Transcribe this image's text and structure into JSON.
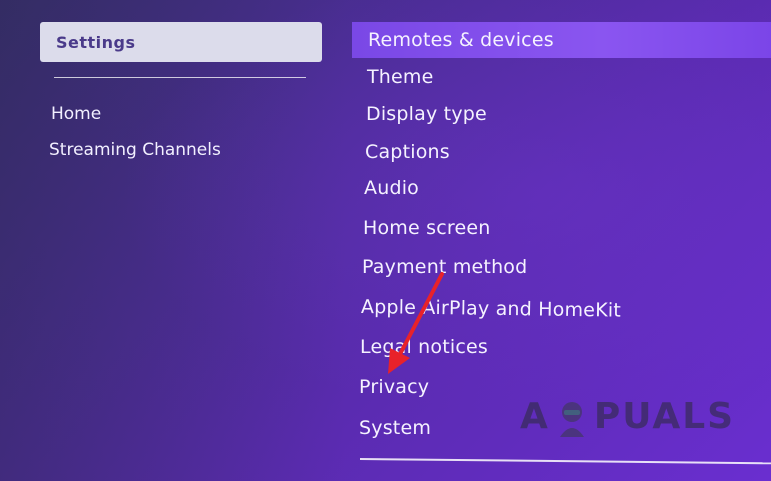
{
  "sidebar": {
    "header": "Settings",
    "items": [
      {
        "label": "Home"
      },
      {
        "label": "Streaming Channels"
      }
    ]
  },
  "menu": {
    "items": [
      {
        "label": "Remotes & devices",
        "selected": true
      },
      {
        "label": "Theme"
      },
      {
        "label": "Display type"
      },
      {
        "label": "Captions"
      },
      {
        "label": "Audio"
      },
      {
        "label": "Home screen"
      },
      {
        "label": "Payment method"
      },
      {
        "label": "Apple AirPlay and HomeKit"
      },
      {
        "label": "Legal notices"
      },
      {
        "label": "Privacy"
      },
      {
        "label": "System"
      }
    ]
  },
  "annotation": {
    "arrow_color": "#e8222a",
    "arrow_icon": "red-arrow-icon"
  },
  "watermark": {
    "text_left": "A",
    "text_right": "PUALS"
  },
  "colors": {
    "background": "#4a2d93",
    "selected_item": "#8a55f0",
    "header_bg": "#dcdceb",
    "header_text": "#4a3a8a"
  }
}
